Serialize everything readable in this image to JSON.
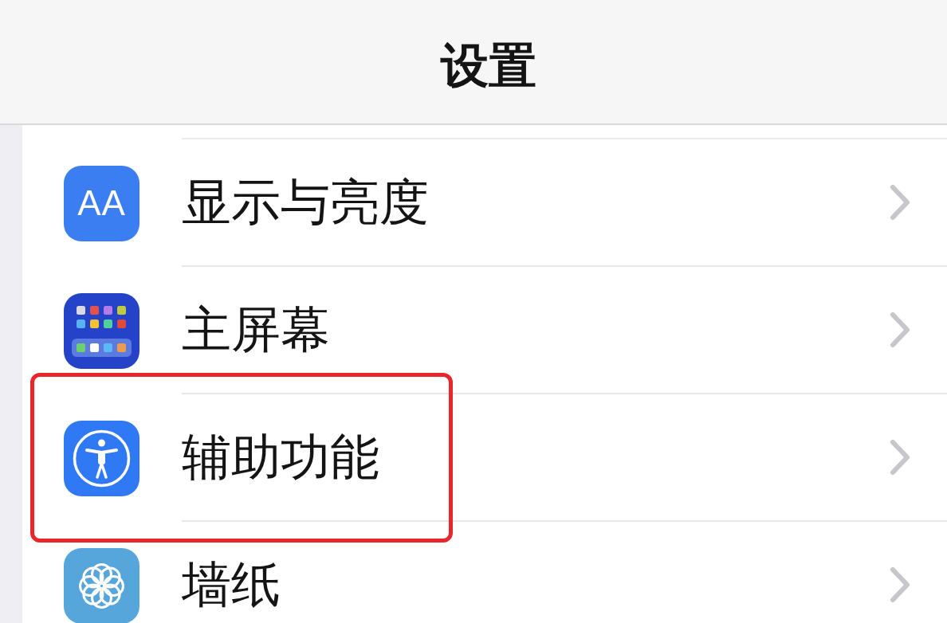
{
  "nav_bar": {
    "title": "设置"
  },
  "settings_rows": [
    {
      "label": "显示与亮度",
      "kind": "display",
      "icon_text": "AA",
      "highlighted": false
    },
    {
      "label": "主屏幕",
      "kind": "home-screen",
      "highlighted": false
    },
    {
      "label": "辅助功能",
      "kind": "accessibility",
      "highlighted": true
    },
    {
      "label": "墙纸",
      "kind": "wallpaper",
      "highlighted": false
    }
  ]
}
